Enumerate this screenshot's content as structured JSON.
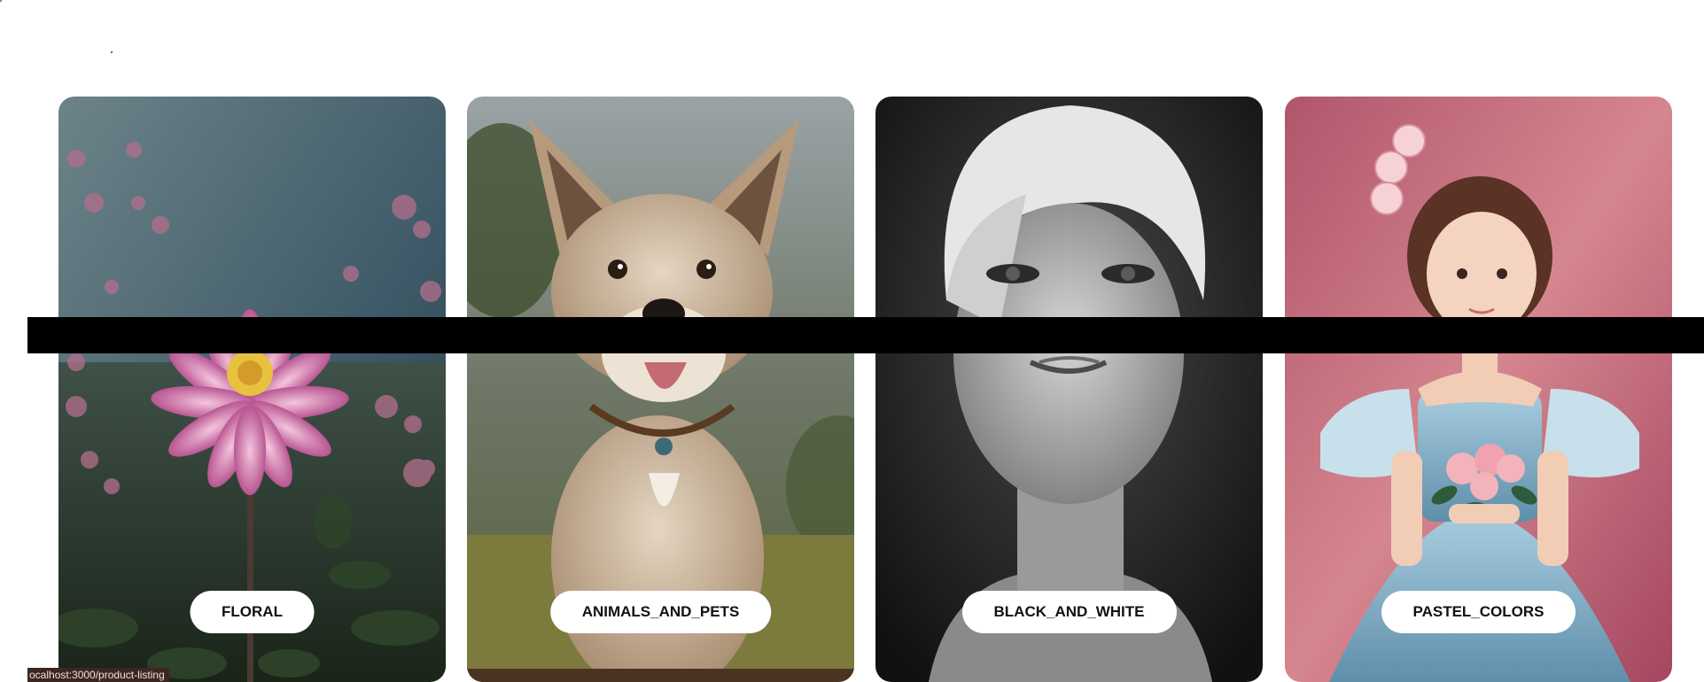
{
  "categories": [
    {
      "label": "FLORAL"
    },
    {
      "label": "ANIMALS_AND_PETS"
    },
    {
      "label": "BLACK_AND_WHITE"
    },
    {
      "label": "PASTEL_COLORS"
    }
  ],
  "status_bar": {
    "url": "ocalhost:3000/product-listing"
  }
}
